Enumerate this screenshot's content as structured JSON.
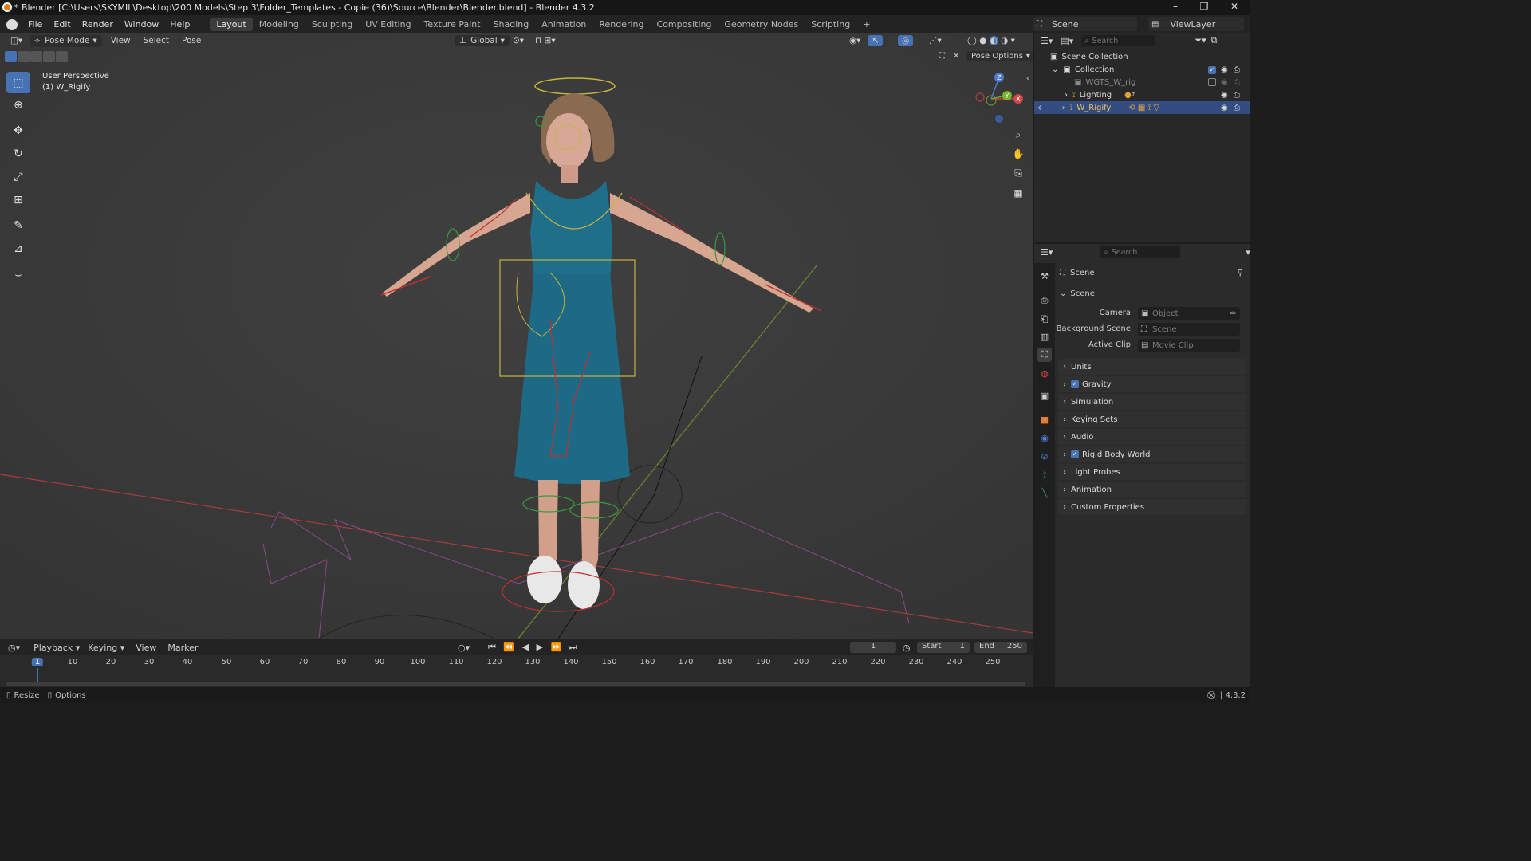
{
  "window": {
    "title": "* Blender [C:\\Users\\SKYMIL\\Desktop\\200 Models\\Step 3\\Folder_Templates - Copie (36)\\Source\\Blender\\Blender.blend] - Blender 4.3.2",
    "minimize": "–",
    "maximize": "❐",
    "close": "✕"
  },
  "menu": {
    "items": [
      "File",
      "Edit",
      "Render",
      "Window",
      "Help"
    ],
    "workspaces": [
      "Layout",
      "Modeling",
      "Sculpting",
      "UV Editing",
      "Texture Paint",
      "Shading",
      "Animation",
      "Rendering",
      "Compositing",
      "Geometry Nodes",
      "Scripting"
    ],
    "active_workspace": "Layout",
    "add_tab": "+",
    "scene": "Scene",
    "view_layer": "ViewLayer"
  },
  "viewport": {
    "mode": "Pose Mode",
    "menus": [
      "View",
      "Select",
      "Pose"
    ],
    "orientation": "Global",
    "pose_options": "Pose Options",
    "overlay_text_1": "User Perspective",
    "overlay_text_2": "(1) W_Rigify",
    "gizmo_labels": {
      "z": "Z",
      "y": "Y",
      "x": "X"
    }
  },
  "outliner": {
    "search_placeholder": "Search",
    "rows": [
      {
        "label": "Scene Collection"
      },
      {
        "label": "Collection"
      },
      {
        "label": "WGTS_W_rig"
      },
      {
        "label": "Lighting",
        "badge": "7"
      },
      {
        "label": "W_Rigify"
      }
    ]
  },
  "properties": {
    "search_placeholder": "Search",
    "context": "Scene",
    "section": "Scene",
    "fields": [
      {
        "label": "Camera",
        "placeholder": "Object"
      },
      {
        "label": "Background Scene",
        "placeholder": "Scene"
      },
      {
        "label": "Active Clip",
        "placeholder": "Movie Clip"
      }
    ],
    "panels": [
      {
        "label": "Units",
        "checkbox": false
      },
      {
        "label": "Gravity",
        "checkbox": true
      },
      {
        "label": "Simulation",
        "checkbox": false
      },
      {
        "label": "Keying Sets",
        "checkbox": false
      },
      {
        "label": "Audio",
        "checkbox": false
      },
      {
        "label": "Rigid Body World",
        "checkbox": true
      },
      {
        "label": "Light Probes",
        "checkbox": false
      },
      {
        "label": "Animation",
        "checkbox": false
      },
      {
        "label": "Custom Properties",
        "checkbox": false
      }
    ]
  },
  "timeline": {
    "menus": [
      "Playback",
      "Keying",
      "View",
      "Marker"
    ],
    "current_frame": "1",
    "start_label": "Start",
    "start": "1",
    "end_label": "End",
    "end": "250",
    "ticks": [
      "1",
      "10",
      "20",
      "30",
      "40",
      "50",
      "60",
      "70",
      "80",
      "90",
      "100",
      "110",
      "120",
      "130",
      "140",
      "150",
      "160",
      "170",
      "180",
      "190",
      "200",
      "210",
      "220",
      "230",
      "240",
      "250"
    ]
  },
  "status": {
    "resize": "Resize",
    "options": "Options",
    "version": "4.3.2"
  },
  "colors": {
    "accent": "#4772b3",
    "viewport_bg": "#3a3a3a",
    "dress": "#1f6f8b",
    "bone_yellow": "#c8b43c",
    "bone_red": "#c03030",
    "bone_green": "#3a9a3a",
    "axis_x": "#b04040",
    "axis_y": "#6a8a30"
  }
}
